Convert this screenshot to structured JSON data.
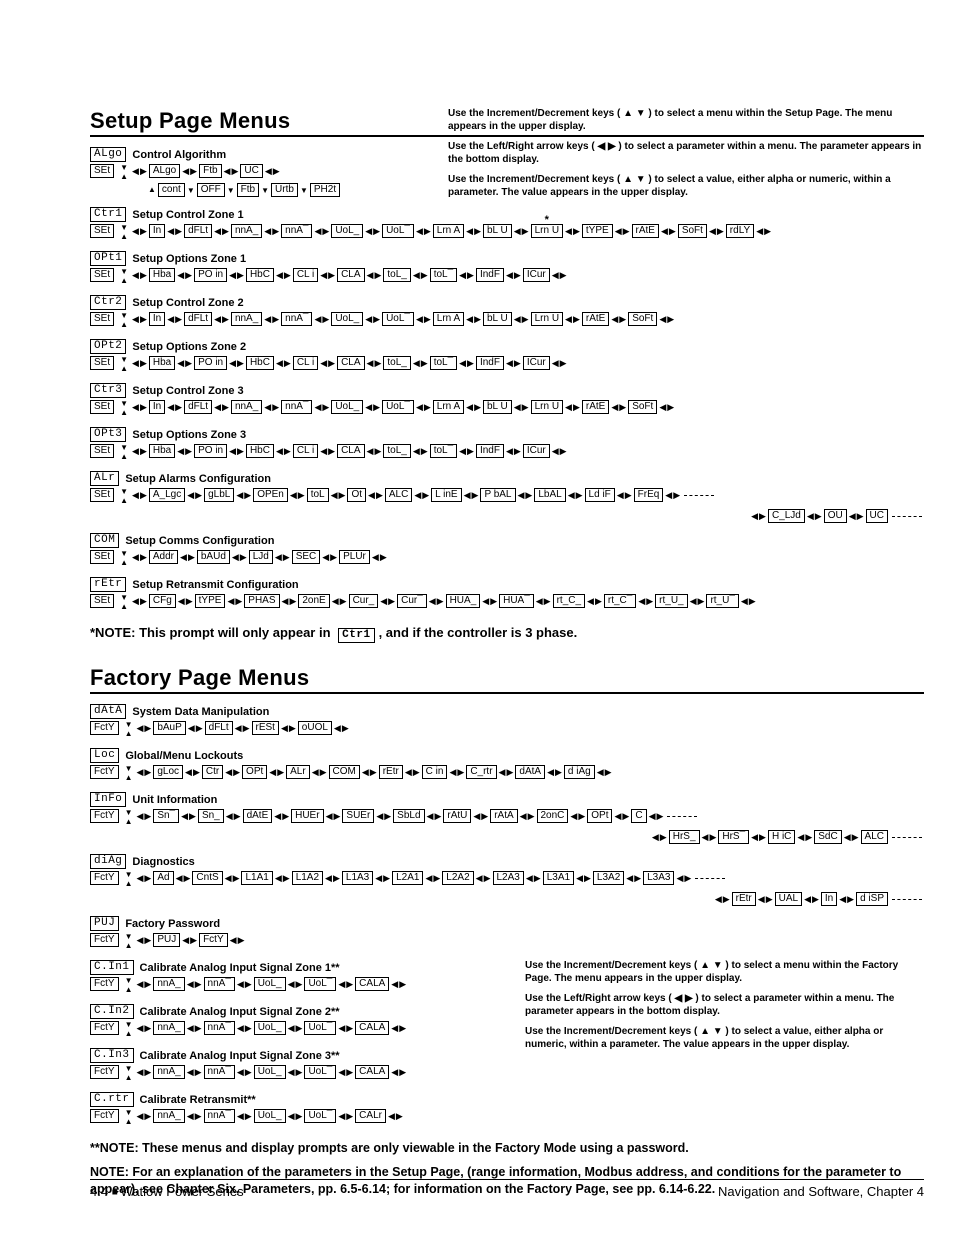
{
  "titles": {
    "setup": "Setup Page Menus",
    "factory": "Factory Page Menus"
  },
  "instructions_setup": [
    "Use the Increment/Decrement keys ( ▲  ▼ ) to select a menu within the Setup Page. The menu appears in the upper display.",
    "Use the Left/Right arrow keys ( ◀  ▶ ) to select a parameter within a menu. The parameter appears in the bottom display.",
    "Use the Increment/Decrement keys ( ▲  ▼ ) to select a value, either alpha or numeric, within a parameter. The value appears in the upper display."
  ],
  "instructions_factory": [
    "Use the Increment/Decrement keys ( ▲  ▼ ) to select a menu within the Factory Page. The menu appears in the upper display.",
    "Use the Left/Right arrow keys ( ◀  ▶ ) to select a parameter within a menu. The parameter appears in the bottom display.",
    "Use the Increment/Decrement keys ( ▲  ▼ ) to select a value, either alpha or numeric, within a parameter. The value appears in the upper display."
  ],
  "setbox": "SEt",
  "fctybox": "FctY",
  "setup_menus": [
    {
      "code": "ALgo",
      "label": "Control Algorithm",
      "params": [
        "ALgo",
        "Ftb",
        "UC"
      ],
      "row2": [
        "cont",
        "OFF",
        "Ftb",
        "Urtb",
        "PH2t"
      ],
      "row2_lead_updown": true
    },
    {
      "code": "Ctr1",
      "label": "Setup Control Zone 1",
      "params": [
        "In",
        "dFLt",
        "nnA_",
        "nnA¯",
        "UoL_",
        "UoL¯",
        "Lrn A",
        "bL  U",
        "Lrn U",
        "tYPE",
        "rAtE",
        "SoFt",
        "rdLY"
      ],
      "star_over_index": 8
    },
    {
      "code": "OPt1",
      "label": "Setup Options Zone 1",
      "params": [
        "Hba",
        "PO in",
        "HbC",
        "CL i",
        "CLA",
        "toL_",
        "toL¯",
        "IndF",
        "ICur"
      ]
    },
    {
      "code": "Ctr2",
      "label": "Setup Control Zone 2",
      "params": [
        "In",
        "dFLt",
        "nnA_",
        "nnA¯",
        "UoL_",
        "UoL¯",
        "Lrn A",
        "bL  U",
        "Lrn U",
        "rAtE",
        "SoFt"
      ]
    },
    {
      "code": "OPt2",
      "label": "Setup Options Zone 2",
      "params": [
        "Hba",
        "PO in",
        "HbC",
        "CL i",
        "CLA",
        "toL_",
        "toL¯",
        "IndF",
        "ICur"
      ]
    },
    {
      "code": "Ctr3",
      "label": "Setup Control Zone 3",
      "params": [
        "In",
        "dFLt",
        "nnA_",
        "nnA¯",
        "UoL_",
        "UoL¯",
        "Lrn A",
        "bL  U",
        "Lrn U",
        "rAtE",
        "SoFt"
      ]
    },
    {
      "code": "OPt3",
      "label": "Setup Options Zone 3",
      "params": [
        "Hba",
        "PO in",
        "HbC",
        "CL i",
        "CLA",
        "toL_",
        "toL¯",
        "IndF",
        "ICur"
      ]
    },
    {
      "code": "ALr",
      "label": "Setup Alarms Configuration",
      "params": [
        "A_Lgc",
        "gLbL",
        "OPEn",
        "toL",
        "Ot",
        "ALC",
        "L inE",
        "P bAL",
        "LbAL",
        "Ld iF",
        "FrEq"
      ],
      "cont": [
        "C_LJd",
        "OU",
        "UC"
      ],
      "dashed": true
    },
    {
      "code": "COM",
      "label": "Setup Comms Configuration",
      "params": [
        "Addr",
        "bAUd",
        "LJd",
        "SEC",
        "PLUr"
      ]
    },
    {
      "code": "rEtr",
      "label": "Setup Retransmit Configuration",
      "params": [
        "CFg",
        "tYPE",
        "PHAS",
        "2onE",
        "Cur_",
        "Cur¯",
        "HUA_",
        "HUA¯",
        "rt_C_",
        "rt_C¯",
        "rt_U_",
        "rt_U¯"
      ]
    }
  ],
  "note_setup": "*NOTE: This prompt will only appear in",
  "note_setup_code": "Ctr1",
  "note_setup_tail": ", and if the controller is 3 phase.",
  "factory_menus": [
    {
      "code": "dAtA",
      "label": "System Data Manipulation",
      "params": [
        "bAuP",
        "dFLt",
        "rESt",
        "oUOL"
      ]
    },
    {
      "code": "Loc",
      "label": "Global/Menu Lockouts",
      "params": [
        "gLoc",
        "Ctr",
        "OPt",
        "ALr",
        "COM",
        "rEtr",
        "C in",
        "C_rtr",
        "dAtA",
        "d iAg"
      ]
    },
    {
      "code": "InFo",
      "label": "Unit Information",
      "params": [
        "Sn¯",
        "Sn_",
        "dAtE",
        "HUEr",
        "SUEr",
        "SbLd",
        "rAtU",
        "rAtA",
        "2onC",
        "OPt",
        "C"
      ],
      "cont": [
        "HrS_",
        "HrS¯",
        "H iC",
        "SdC",
        "ALC"
      ],
      "dashed": true
    },
    {
      "code": "diAg",
      "label": "Diagnostics",
      "params": [
        "Ad",
        "CntS",
        "L1A1",
        "L1A2",
        "L1A3",
        "L2A1",
        "L2A2",
        "L2A3",
        "L3A1",
        "L3A2",
        "L3A3"
      ],
      "cont": [
        "rEtr",
        "UAL",
        "In",
        "d iSP"
      ],
      "dashed": true
    },
    {
      "code": "PUJ",
      "label": "Factory Password",
      "params": [
        "PUJ",
        "FctY"
      ]
    },
    {
      "code": "C.In1",
      "label": "Calibrate Analog Input Signal Zone 1**",
      "params": [
        "nnA_",
        "nnA¯",
        "UoL_",
        "UoL¯",
        "CALA"
      ]
    },
    {
      "code": "C.In2",
      "label": "Calibrate Analog Input Signal Zone 2**",
      "params": [
        "nnA_",
        "nnA¯",
        "UoL_",
        "UoL¯",
        "CALA"
      ]
    },
    {
      "code": "C.In3",
      "label": "Calibrate Analog Input Signal Zone 3**",
      "params": [
        "nnA_",
        "nnA¯",
        "UoL_",
        "UoL¯",
        "CALA"
      ]
    },
    {
      "code": "C.rtr",
      "label": "Calibrate Retransmit**",
      "params": [
        "nnA_",
        "nnA¯",
        "UoL_",
        "UoL¯",
        "CALr"
      ]
    }
  ],
  "bottom_notes": [
    "**NOTE: These menus and display prompts are only viewable in the Factory Mode using a password.",
    "NOTE: For an explanation of the parameters in the Setup Page, (range information, Modbus address, and conditions for the parameter to appear), see Chapter Six, Parameters, pp. 6.5-6.14; for information on the Factory Page, see pp. 6.14-6.22."
  ],
  "footer": {
    "left_a": "4.4",
    "left_b": "Watlow Power Series",
    "right": "Navigation and Software, Chapter 4"
  }
}
